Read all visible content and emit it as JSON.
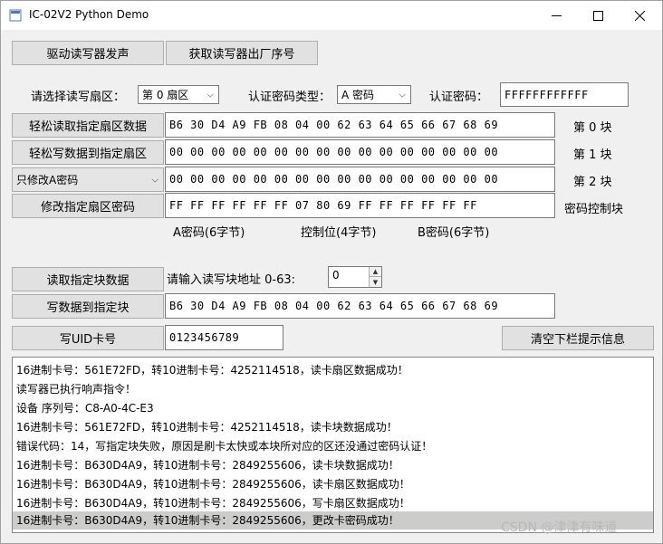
{
  "window": {
    "title": "IC-02V2 Python Demo",
    "minimize_icon": "minimize-icon",
    "maximize_icon": "maximize-icon",
    "close_icon": "close-icon"
  },
  "toolbar": {
    "beep_label": "驱动读写器发声",
    "serial_label": "获取读写器出厂序号"
  },
  "sector_row": {
    "sector_label": "请选择读写扇区：",
    "sector_value": "第 0 扇区",
    "key_type_label": "认证密码类型：",
    "key_type_value": "A 密码",
    "key_label": "认证密码：",
    "key_value": "FFFFFFFFFFFF"
  },
  "blocks": {
    "read_sector_label": "轻松读取指定扇区数据",
    "write_sector_label": "轻松写数据到指定扇区",
    "modify_mode_value": "只修改A密码",
    "modify_key_label": "修改指定扇区密码",
    "block0_data": "B6 30 D4 A9 FB 08 04 00 62 63 64 65 66 67 68 69",
    "block1_data": "00 00 00 00 00 00 00 00 00 00 00 00 00 00 00 00",
    "block2_data": "00 00 00 00 00 00 00 00 00 00 00 00 00 00 00 00",
    "control_block_data": "FF FF FF FF FF FF 07 80 69 FF FF FF FF FF FF",
    "block0_label": "第 0 块",
    "block1_label": "第 1 块",
    "block2_label": "第 2 块",
    "control_block_label": "密码控制块",
    "key_a_caption": "A密码(6字节)",
    "access_bits_caption": "控制位(4字节)",
    "key_b_caption": "B密码(6字节)"
  },
  "single_block": {
    "read_label": "读取指定块数据",
    "address_label": "请输入读写块地址 0-63:",
    "address_value": "0",
    "write_label": "写数据到指定块",
    "write_data": "B6 30 D4 A9 FB 08 04 00 62 63 64 65 66 67 68 69"
  },
  "uid": {
    "write_uid_label": "写UID卡号",
    "uid_value": "0123456789",
    "clear_label": "清空下栏提示信息"
  },
  "log": [
    "16进制卡号：561E72FD，转10进制卡号：4252114518，读卡扇区数据成功！",
    "读写器已执行响声指令！",
    "设备 序列号：C8-A0-4C-E3",
    "16进制卡号：561E72FD，转10进制卡号：4252114518，读卡块数据成功！",
    "错误代码：14，写指定块失败，原因是刷卡太快或本块所对应的区还没通过密码认证！",
    "16进制卡号：B630D4A9，转10进制卡号：2849255606，读卡块数据成功！",
    "16进制卡号：B630D4A9，转10进制卡号：2849255606，读卡扇区数据成功！",
    "16进制卡号：B630D4A9，转10进制卡号：2849255606，写卡扇区数据成功！",
    "16进制卡号：B630D4A9，转10进制卡号：2849255606，更改卡密码成功！"
  ],
  "watermark": "CSDN @津津有味道"
}
